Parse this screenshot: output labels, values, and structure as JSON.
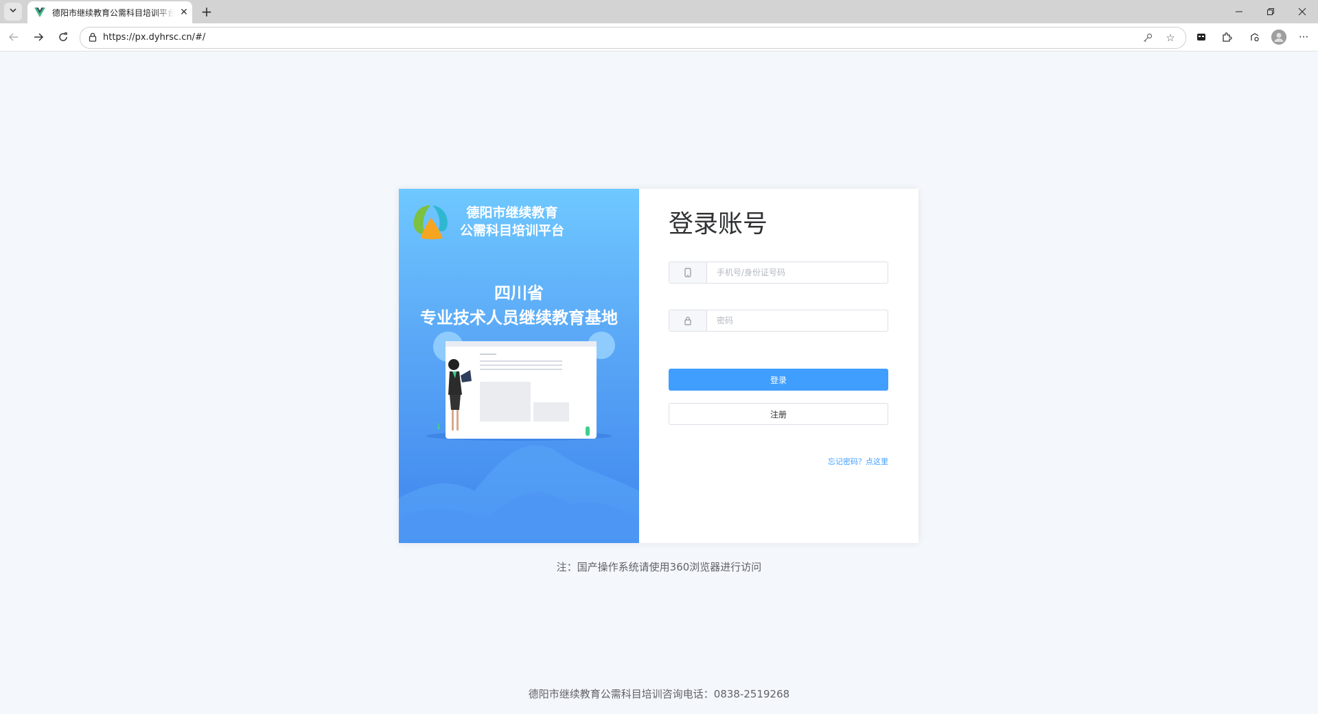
{
  "browser": {
    "tab_title": "德阳市继续教育公需科目培训平台",
    "url": "https://px.dyhrsc.cn/#/"
  },
  "icons": {
    "tab_dropdown": "chevron-down-icon",
    "favicon": "vue-logo-icon",
    "tab_close": "close-icon",
    "new_tab": "plus-icon",
    "back": "arrow-left-icon",
    "forward": "arrow-right-icon",
    "reload": "reload-icon",
    "lock": "lock-icon",
    "key": "key-icon",
    "favorite": "star-icon",
    "profile": "avatar-icon",
    "menu": "more-icon"
  },
  "banner": {
    "site_name_line1": "德阳市继续教育",
    "site_name_line2": "公需科目培训平台",
    "headline_line1": "四川省",
    "headline_line2": "专业技术人员继续教育基地"
  },
  "login": {
    "title": "登录账号",
    "username_placeholder": "手机号/身份证号码",
    "password_placeholder": "密码",
    "login_button": "登录",
    "register_button": "注册",
    "forgot_link": "忘记密码？点这里"
  },
  "note": "注：国产操作系统请使用360浏览器进行访问",
  "footer": "德阳市继续教育公需科目培训咨询电话：0838-2519268",
  "colors": {
    "primary": "#409eff",
    "banner_top": "#6fc8ff",
    "banner_bottom": "#3f86ee",
    "page_bg": "#f4f7fc"
  }
}
